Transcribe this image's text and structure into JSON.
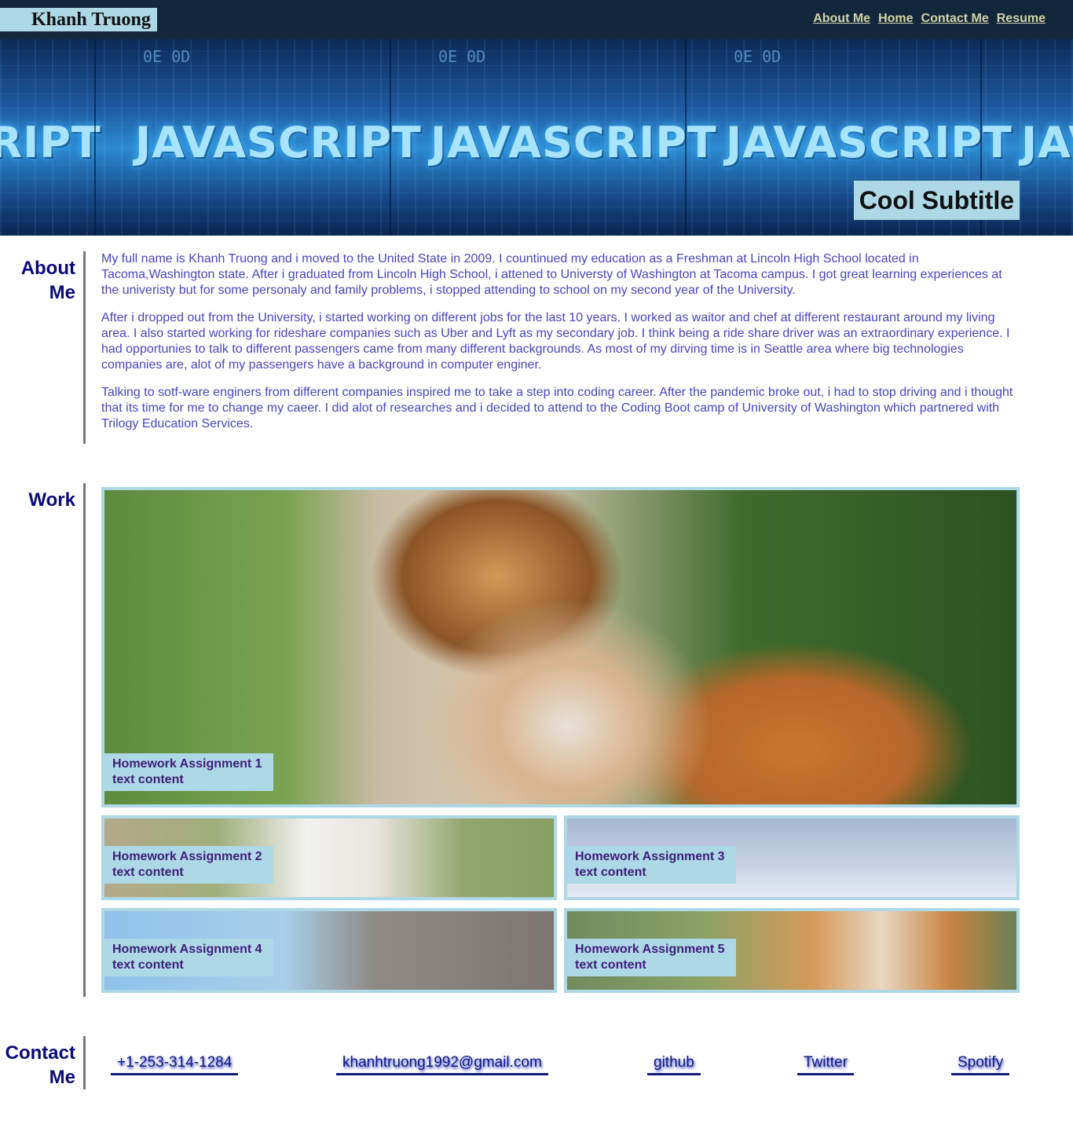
{
  "header": {
    "brand": "Khanh Truong",
    "nav": [
      "About Me",
      "Home",
      "Contact Me",
      "Resume"
    ]
  },
  "hero": {
    "word": "JAVASCRIPT",
    "subtitle": "Cool Subtitle"
  },
  "about": {
    "title_line1": "About",
    "title_line2": "Me",
    "paragraphs": [
      "My full name is Khanh Truong and i moved to the United State in 2009. I countinued my education as a Freshman at Lincoln High School located in Tacoma,Washington state. After i graduated from Lincoln High School, i attened to Universty of Washington at Tacoma campus. I got great learning experiences at the univeristy but for some personaly and family problems, i stopped attending to school on my second year of the University.",
      "After i dropped out from the University, i started working on different jobs for the last 10 years. I worked as waitor and chef at different restaurant around my living area. I also started working for rideshare companies such as Uber and Lyft as my secondary job. I think being a ride share driver was an extraordinary experience. I had opportunies to talk to different passengers came from many different backgrounds. As most of my dirving time is in Seattle area where big technologies companies are, alot of my passengers have a background in computer enginer.",
      "Talking to sotf-ware enginers from different companies inspired me to take a step into coding career. After the pandemic broke out, i had to stop driving and i thought that its time for me to change my caeer. I did alot of researches and i decided to attend to the Coding Boot camp of University of Washington which partnered with Trilogy Education Services."
    ]
  },
  "work": {
    "title": "Work",
    "items": [
      {
        "line1": "Homework Assignment 1",
        "line2": "text content",
        "image": "tiger"
      },
      {
        "line1": "Homework Assignment 2",
        "line2": "text content",
        "image": "white-lion"
      },
      {
        "line1": "Homework Assignment 3",
        "line2": "text content",
        "image": "dolphins"
      },
      {
        "line1": "Homework Assignment 4",
        "line2": "text content",
        "image": "elephants"
      },
      {
        "line1": "Homework Assignment 5",
        "line2": "text content",
        "image": "corgis"
      }
    ]
  },
  "contact": {
    "title_line1": "Contact",
    "title_line2": "Me",
    "links": [
      "+1-253-314-1284",
      "khanhtruong1992@gmail.com",
      "github",
      "Twitter",
      "Spotify"
    ]
  },
  "colors": {
    "header_bg": "#12263c",
    "accent": "#add8e6",
    "nav_link": "#d4d4a8",
    "section_title": "#0a0a7a",
    "body_text": "#4a44c0",
    "card_caption": "#3f1d7a"
  }
}
